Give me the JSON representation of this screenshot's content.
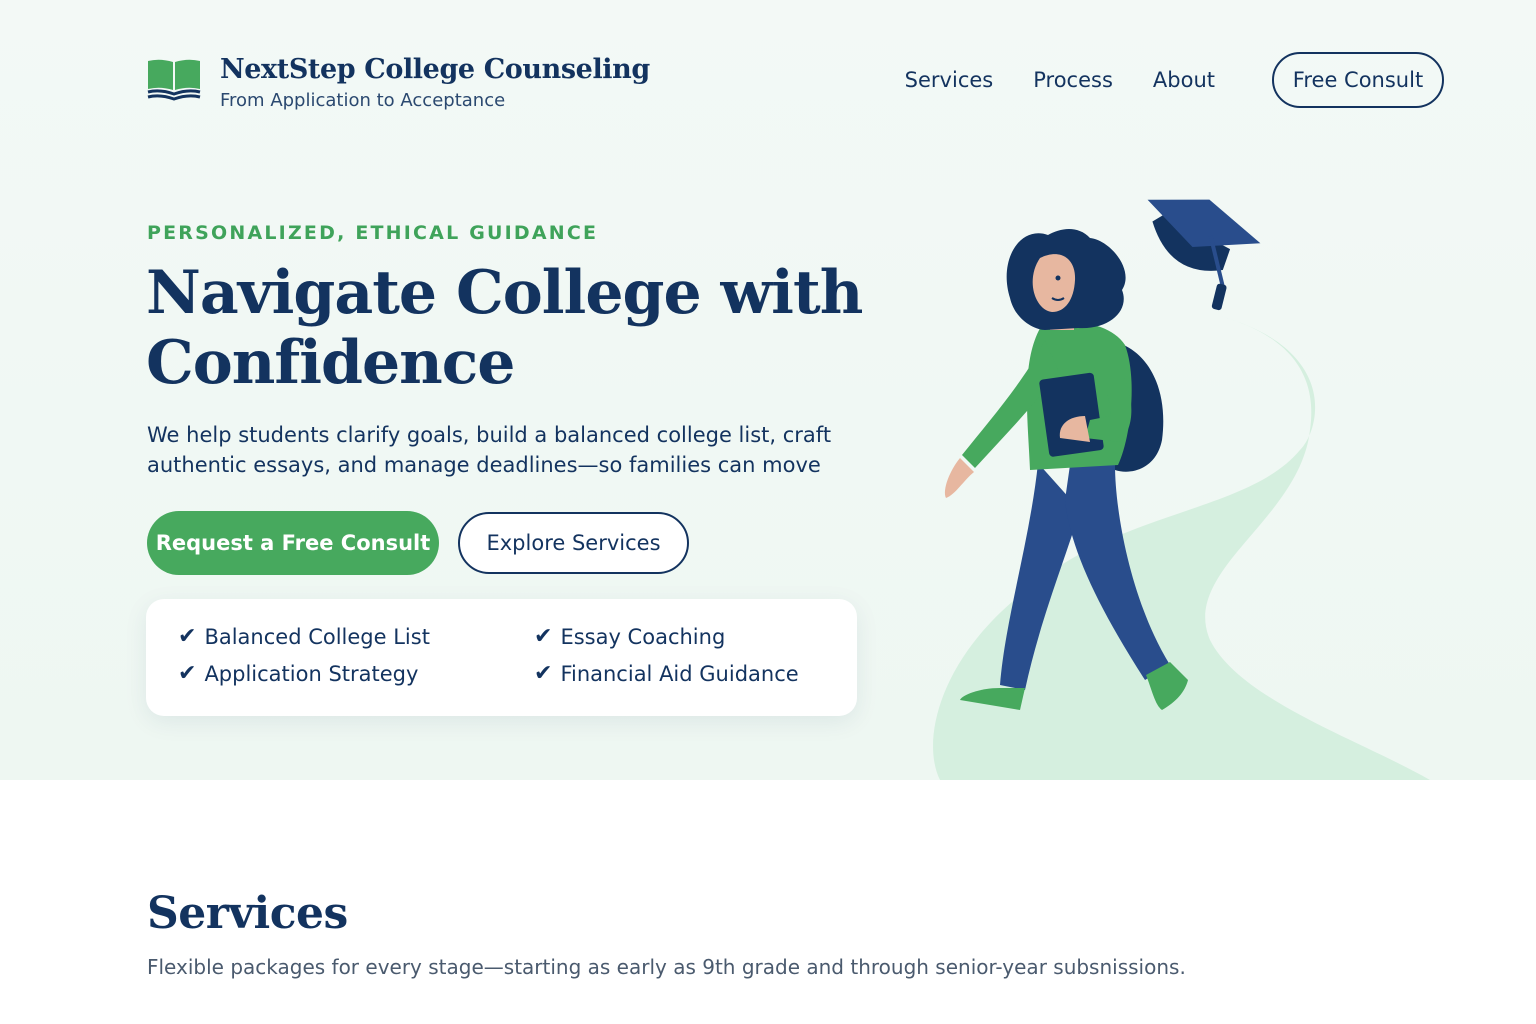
{
  "brand": {
    "title": "NextStep College Counseling",
    "tagline": "From Application to Acceptance",
    "logo_icon": "open-book-icon"
  },
  "nav": {
    "links": [
      "Services",
      "Process",
      "About"
    ],
    "cta": "Free Consult"
  },
  "hero": {
    "eyebrow": "PERSONALIZED, ETHICAL GUIDANCE",
    "headline": "Navigate College with Confidence",
    "lede": "We help students clarify goals, build a balanced college list, craft authentic essays, and manage deadlines—so families can move from",
    "primary_cta": "Request a Free Consult",
    "secondary_cta": "Explore Services",
    "features": [
      "Balanced College List",
      "Essay Coaching",
      "Application Strategy",
      "Financial Aid Guidance"
    ],
    "check_glyph": "✔",
    "illustration": "student-walking-with-graduation-cap-icon"
  },
  "services": {
    "title": "Services",
    "subtitle": "Flexible packages for every stage—starting as early as 9th grade and through senior-year subsnissions."
  },
  "colors": {
    "navy": "#13335f",
    "green": "#47a95e",
    "hero_bg": "#f1f8f4"
  }
}
